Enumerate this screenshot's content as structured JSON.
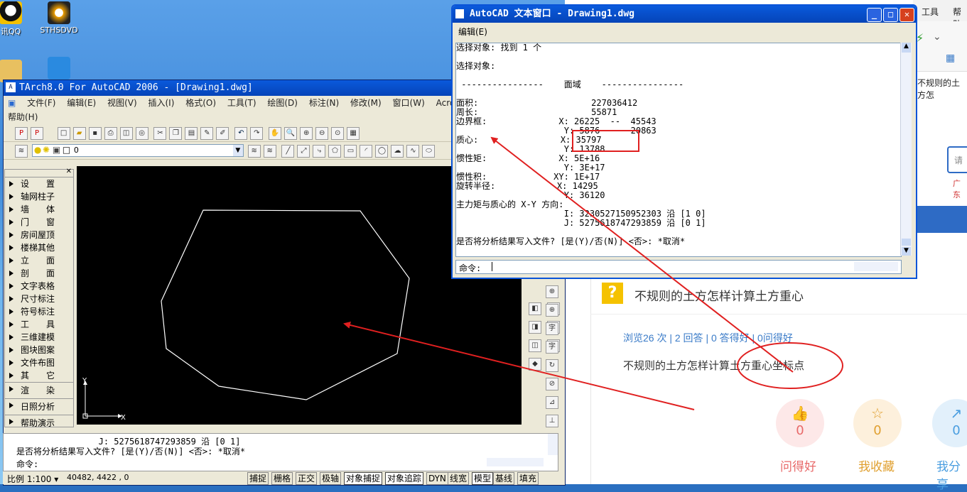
{
  "desktop": {
    "icons": [
      {
        "label": "讯QQ"
      },
      {
        "label": "STHSDVD"
      }
    ]
  },
  "browser": {
    "menu": [
      "工具",
      "帮助"
    ],
    "link_snippet": "不规则的土方怎",
    "search_placeholder": "请",
    "side_text": "广东",
    "question_title": "不规则的土方怎样计算土方重心",
    "stats": "浏览26 次 | 2 回答 | 0 答得好 | 0问得好",
    "body": "不规则的土方怎样计算土方重心坐标点",
    "actions": [
      {
        "label": "问得好",
        "count": "0",
        "icon": "thumb-up-icon",
        "color": "#e86a6a"
      },
      {
        "label": "我收藏",
        "count": "0",
        "icon": "star-icon",
        "color": "#e0a030"
      },
      {
        "label": "我分享",
        "count": "0",
        "icon": "share-icon",
        "color": "#4a9ee0"
      }
    ]
  },
  "acad": {
    "title": "TArch8.0 For AutoCAD 2006 - [Drawing1.dwg]",
    "menu": [
      "文件(F)",
      "编辑(E)",
      "视图(V)",
      "插入(I)",
      "格式(O)",
      "工具(T)",
      "绘图(D)",
      "标注(N)",
      "修改(M)",
      "窗口(W)",
      "Acrobat 标"
    ],
    "menu2": "帮助(H)",
    "layer": "0",
    "panel_items": [
      "设　　置",
      "轴网柱子",
      "墙　　体",
      "门　　窗",
      "房间屋顶",
      "楼梯其他",
      "立　　面",
      "剖　　面",
      "文字表格",
      "尺寸标注",
      "符号标注",
      "工　　具",
      "三维建模",
      "图块图案",
      "文件布图",
      "其　　它",
      "渲　　染",
      "日照分析",
      "帮助演示"
    ],
    "axis_y": "Y",
    "axis_x": "X",
    "cmd_lines": [
      "                J: 5275618747293859 沿 [0 1]",
      "是否将分析结果写入文件? [是(Y)/否(N)] <否>: *取消*"
    ],
    "cmd_prompt": "命令:",
    "status": {
      "scale": "比例 1:100 ▾",
      "coords": "40482, 4422 , 0",
      "buttons": [
        "捕捉",
        "栅格",
        "正交",
        "极轴",
        "对象捕捉",
        "对象追踪",
        "DYN",
        "线宽",
        "模型"
      ],
      "right": [
        "基线",
        "填充"
      ]
    }
  },
  "textwin": {
    "title": "AutoCAD 文本窗口 - Drawing1.dwg",
    "menu": "编辑(E)",
    "lines": [
      "选择对象: 找到 1 个",
      "",
      "选择对象:",
      "",
      " ----------------    面域    ----------------",
      "",
      "面积:                      227036412",
      "周长:                      55871",
      "边界框:              X: 26225  --  45543",
      "                     Y: 5876  --  20863",
      "质心:                X: 35797",
      "                     Y: 13788",
      "惯性矩:              X: 5E+16",
      "                     Y: 3E+17",
      "惯性积:             XY: 1E+17",
      "旋转半径:            X: 14295",
      "                     Y: 36120",
      "主力矩与质心的 X-Y 方向:",
      "                     I: 3230527150952303 沿 [1 0]",
      "                     J: 5275618747293859 沿 [0 1]",
      "",
      "是否将分析结果写入文件? [是(Y)/否(N)] <否>: *取消*"
    ],
    "cmd_prompt": "命令:"
  },
  "annotation_color": "#e02020"
}
